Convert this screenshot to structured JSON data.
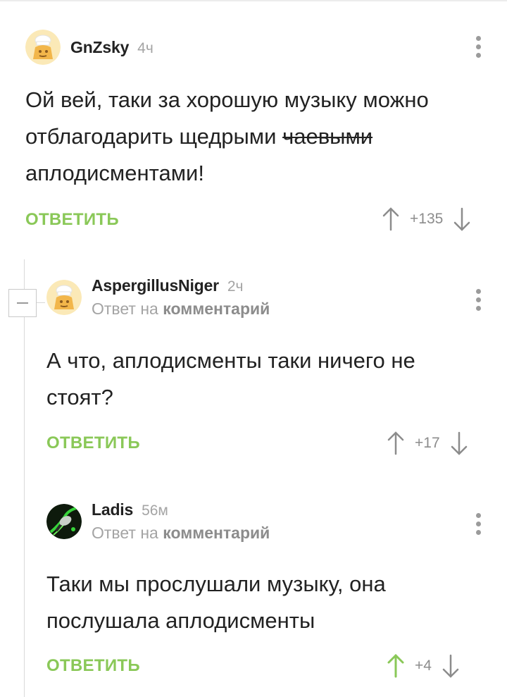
{
  "comments": [
    {
      "author": "GnZsky",
      "time": "4ч",
      "text_parts": [
        "Ой вей, таки за хорошую музыку можно отблагодарить щедрыми ",
        "чаевыми",
        " аплодисментами!"
      ],
      "reply_label": "ОТВЕТИТЬ",
      "score": "+135"
    },
    {
      "author": "AspergillusNiger",
      "time": "2ч",
      "reply_prefix": "Ответ на",
      "reply_target": "комментарий",
      "text": "А что, аплодисменты таки ничего не стоят?",
      "reply_label": "ОТВЕТИТЬ",
      "score": "+17"
    },
    {
      "author": "Ladis",
      "time": "56м",
      "reply_prefix": "Ответ на",
      "reply_target": "комментарий",
      "text": "Таки мы прослушали музыку, она послушала аплодисменты",
      "reply_label": "ОТВЕТИТЬ",
      "score": "+4",
      "upvoted": true
    }
  ],
  "colors": {
    "accent_green": "#8ac858",
    "text": "#222222",
    "muted": "#a4a4a4",
    "thread_line": "#d9d9d9"
  },
  "icons": [
    "chef-avatar-icon",
    "dark-green-avatar-icon",
    "more-vertical-icon",
    "arrow-up-icon",
    "arrow-down-icon",
    "collapse-minus-icon"
  ]
}
